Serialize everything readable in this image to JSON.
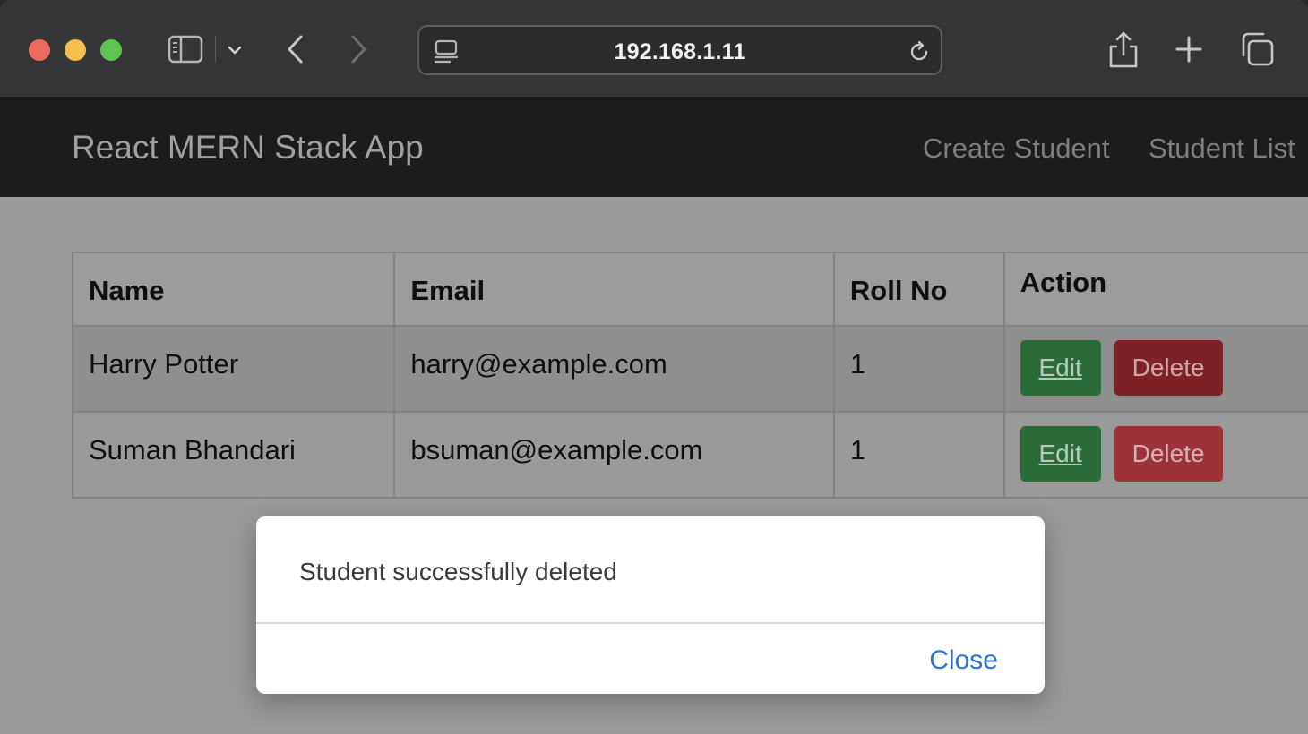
{
  "browser": {
    "url": "192.168.1.11",
    "icons": {
      "sidebar": "sidebar-icon",
      "tabs_dropdown": "chevron-down-icon",
      "back": "chevron-left-icon",
      "forward": "chevron-right-icon",
      "site": "site-settings-icon",
      "reload": "reload-icon",
      "share": "share-icon",
      "new_tab": "plus-icon",
      "tab_overview": "tab-overview-icon"
    },
    "traffic_colors": {
      "close": "#ed6a5e",
      "minimize": "#f5bf4f",
      "zoom": "#61c454"
    }
  },
  "navbar": {
    "brand": "React MERN Stack App",
    "links": [
      "Create Student",
      "Student List"
    ]
  },
  "table": {
    "headers": [
      "Name",
      "Email",
      "Roll No",
      "Action"
    ],
    "rows": [
      {
        "name": "Harry Potter",
        "email": "harry@example.com",
        "roll": "1",
        "edit_label": "Edit",
        "delete_label": "Delete"
      },
      {
        "name": "Suman Bhandari",
        "email": "bsuman@example.com",
        "roll": "1",
        "edit_label": "Edit",
        "delete_label": "Delete"
      }
    ]
  },
  "modal": {
    "message": "Student successfully deleted",
    "close_label": "Close"
  },
  "colors": {
    "edit_button": "#2a6b37",
    "delete_button": "#7d2125",
    "modal_link": "#2f72d6",
    "navbar": "#1a1c1e"
  }
}
